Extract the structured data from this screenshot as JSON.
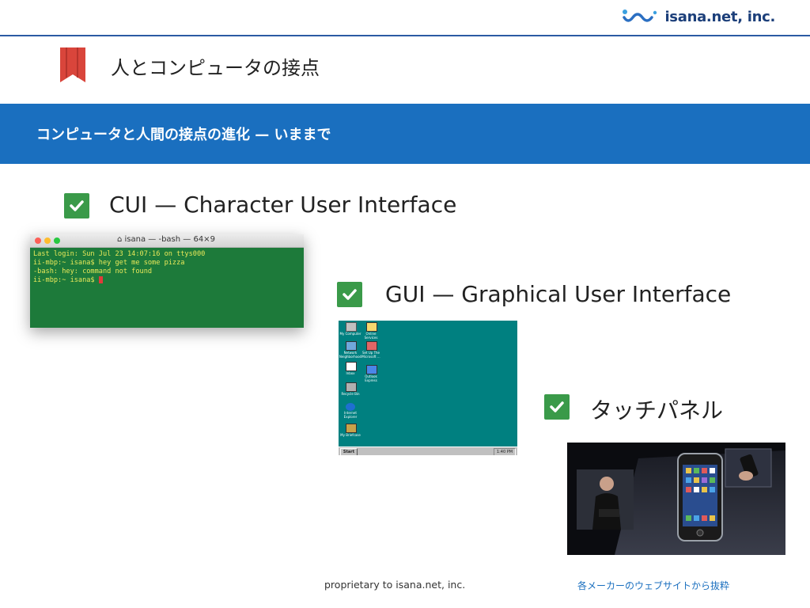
{
  "header": {
    "logo_text": "isana.net, inc.",
    "title": "人とコンピュータの接点"
  },
  "section": {
    "band_text": "コンピュータと人間の接点の進化 — いままで"
  },
  "items": [
    {
      "label": "CUI — Character User Interface"
    },
    {
      "label": "GUI — Graphical User Interface"
    },
    {
      "label": "タッチパネル"
    }
  ],
  "terminal": {
    "title": "isana — -bash — 64×9",
    "lines": [
      "Last login: Sun Jul 23 14:07:16 on ttys000",
      "ii-mbp:~ isana$ hey get me some pizza",
      "-bash: hey: command not found",
      "ii-mbp:~ isana$ "
    ]
  },
  "desktop": {
    "icons": [
      "My Computer",
      "Online Services",
      "Network Neighborhood",
      "Set Up The Microsoft ...",
      "Inbox",
      "Outlook Express",
      "Recycle Bin",
      "Internet Explorer",
      "My Briefcase"
    ],
    "start_label": "Start",
    "clock": "1:40 PM"
  },
  "footer": {
    "left": "proprietary to isana.net, inc.",
    "right": "各メーカーのウェブサイトから抜粋"
  },
  "colors": {
    "accent_blue": "#1a6fbf",
    "check_green": "#3a9a49",
    "ribbon_red": "#d9453b",
    "terminal_green": "#1d7a3a",
    "desktop_teal": "#008080"
  }
}
